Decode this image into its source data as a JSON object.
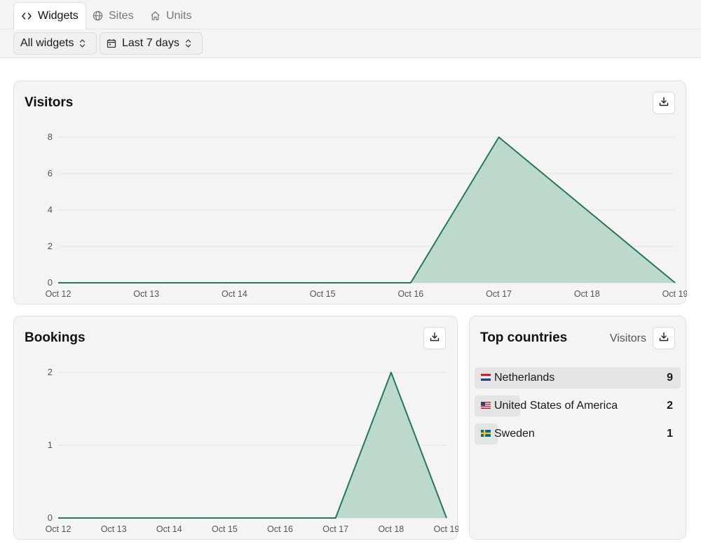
{
  "tabs": [
    {
      "label": "Widgets",
      "icon": "code-icon",
      "active": true
    },
    {
      "label": "Sites",
      "icon": "globe-icon",
      "active": false
    },
    {
      "label": "Units",
      "icon": "home-icon",
      "active": false
    }
  ],
  "filters": {
    "widget_select": "All widgets",
    "date_select": "Last 7 days",
    "date_icon": "calendar-icon"
  },
  "colors": {
    "series_line": "#237a57",
    "series_fill": "#bcd9cb",
    "bar_highlight": "#e4e4e4"
  },
  "visitors_card": {
    "title": "Visitors",
    "download_icon": "download-icon"
  },
  "bookings_card": {
    "title": "Bookings",
    "download_icon": "download-icon"
  },
  "countries_card": {
    "title": "Top countries",
    "metric": "Visitors",
    "download_icon": "download-icon",
    "rows": [
      {
        "name": "Netherlands",
        "count": "9",
        "value": 9,
        "flag": "netherlands-flag-icon"
      },
      {
        "name": "United States of America",
        "count": "2",
        "value": 2,
        "flag": "usa-flag-icon"
      },
      {
        "name": "Sweden",
        "count": "1",
        "value": 1,
        "flag": "sweden-flag-icon"
      }
    ]
  },
  "chart_data": [
    {
      "type": "area",
      "title": "Visitors",
      "x": [
        "Oct 12",
        "Oct 13",
        "Oct 14",
        "Oct 15",
        "Oct 16",
        "Oct 17",
        "Oct 18",
        "Oct 19"
      ],
      "series": [
        {
          "values": [
            0,
            0,
            0,
            0,
            0,
            8,
            4,
            0
          ]
        }
      ],
      "ylim": [
        0,
        8
      ],
      "yticks": [
        0,
        2,
        4,
        6,
        8
      ],
      "grid": true
    },
    {
      "type": "area",
      "title": "Bookings",
      "x": [
        "Oct 12",
        "Oct 13",
        "Oct 14",
        "Oct 15",
        "Oct 16",
        "Oct 17",
        "Oct 18",
        "Oct 19"
      ],
      "series": [
        {
          "values": [
            0,
            0,
            0,
            0,
            0,
            0,
            2,
            0
          ]
        }
      ],
      "ylim": [
        0,
        2
      ],
      "yticks": [
        0,
        1,
        2
      ],
      "grid": true
    }
  ]
}
